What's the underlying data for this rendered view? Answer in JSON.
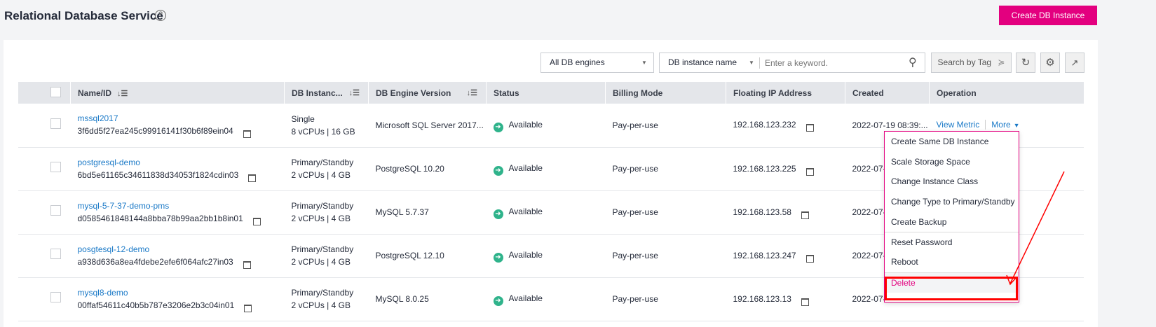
{
  "header": {
    "title": "Relational Database Service",
    "help_icon": "question-circle-icon",
    "create_button": "Create DB Instance",
    "accent": "#e3007f"
  },
  "toolbar": {
    "engine_filter": "All DB engines",
    "search_field": "DB instance name",
    "search_placeholder": "Enter a keyword.",
    "search_by_tag": "Search by Tag"
  },
  "table": {
    "columns": [
      "Name/ID",
      "DB Instanc...",
      "DB Engine Version",
      "Status",
      "Billing Mode",
      "Floating IP Address",
      "Created",
      "Operation"
    ],
    "rows": [
      {
        "name": "mssql2017",
        "id": "3f6dd5f27ea245c99916141f30b6f89ein04",
        "type": "Single",
        "spec": "8 vCPUs | 16 GB",
        "engine": "Microsoft SQL Server 2017...",
        "status": "Available",
        "billing": "Pay-per-use",
        "ip": "192.168.123.232",
        "created": "2022-07-19 08:39:...",
        "view": "View Metric",
        "more": "More"
      },
      {
        "name": "postgresql-demo",
        "id": "6bd5e61165c34611838d34053f1824cdin03",
        "type": "Primary/Standby",
        "spec": "2 vCPUs | 4 GB",
        "engine": "PostgreSQL 10.20",
        "status": "Available",
        "billing": "Pay-per-use",
        "ip": "192.168.123.225",
        "created": "2022-07-",
        "view": "",
        "more": ""
      },
      {
        "name": "mysql-5-7-37-demo-pms",
        "id": "d0585461848144a8bba78b99aa2bb1b8in01",
        "type": "Primary/Standby",
        "spec": "2 vCPUs | 4 GB",
        "engine": "MySQL 5.7.37",
        "status": "Available",
        "billing": "Pay-per-use",
        "ip": "192.168.123.58",
        "created": "2022-07-",
        "view": "",
        "more": ""
      },
      {
        "name": "posgtesql-12-demo",
        "id": "a938d636a8ea4fdebe2efe6f064afc27in03",
        "type": "Primary/Standby",
        "spec": "2 vCPUs | 4 GB",
        "engine": "PostgreSQL 12.10",
        "status": "Available",
        "billing": "Pay-per-use",
        "ip": "192.168.123.247",
        "created": "2022-07-",
        "view": "",
        "more": ""
      },
      {
        "name": "mysql8-demo",
        "id": "00ffaf54611c40b5b787e3206e2b3c04in01",
        "type": "Primary/Standby",
        "spec": "2 vCPUs | 4 GB",
        "engine": "MySQL 8.0.25",
        "status": "Available",
        "billing": "Pay-per-use",
        "ip": "192.168.123.13",
        "created": "2022-07-",
        "view": "",
        "more": ""
      }
    ]
  },
  "more_menu": {
    "items": [
      "Create Same DB Instance",
      "Scale Storage Space",
      "Change Instance Class",
      "Change Type to Primary/Standby",
      "Create Backup",
      "Reset Password",
      "Reboot",
      "Delete"
    ]
  }
}
